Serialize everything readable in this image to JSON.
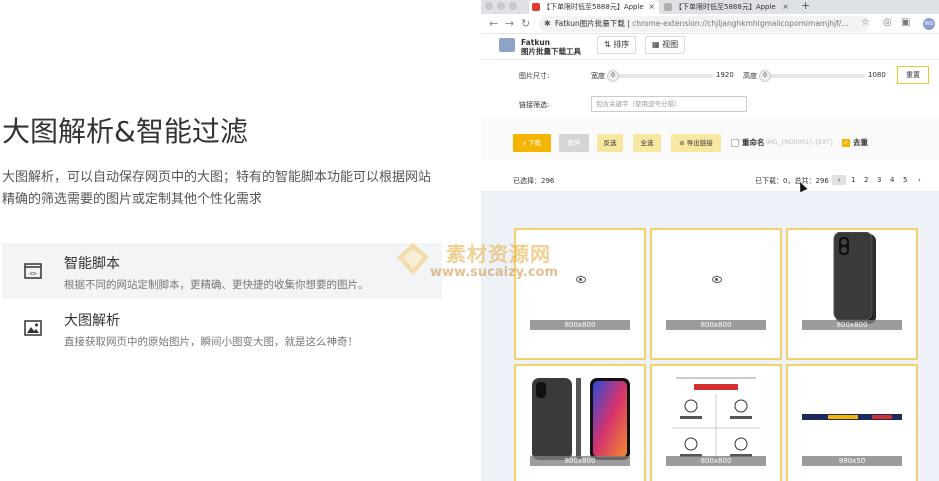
{
  "hero": {
    "title": "大图解析&智能过滤",
    "description": "大图解析，可以自动保存网页中的大图；特有的智能脚本功能可以根据网站精确的筛选需要的图片或定制其他个性化需求"
  },
  "features": [
    {
      "icon": "code-window-icon",
      "name": "智能脚本",
      "desc": "根据不同的网站定制脚本，更精确、更快捷的收集你想要的图片。"
    },
    {
      "icon": "image-icon",
      "name": "大图解析",
      "desc": "直接获取网页中的原始图片，瞬间小图变大图，就是这么神奇！"
    }
  ],
  "browser": {
    "tabs": [
      {
        "title": "【下单限时低至5888元】Apple",
        "close": "×"
      },
      {
        "title": "【下单限时低至5888元】Apple",
        "close": "×"
      }
    ],
    "new_tab": "+",
    "omnibox": {
      "site": "Fatkun图片批量下载",
      "url": "chrome-extension://chjljanghkmhlgmaiicopomimamjhjf/..."
    },
    "profile": "WG"
  },
  "extension": {
    "brand_line1": "Fatkun",
    "brand_line2": "图片批量下载工具",
    "sort_label": "排序",
    "view_label": "视图",
    "size_label": "图片尺寸:",
    "width_label": "宽度",
    "width_min": "0",
    "width_max": "1920",
    "height_label": "高度",
    "height_min": "0",
    "height_max": "1080",
    "reset_label": "重置",
    "filter_label": "链接筛选:",
    "filter_placeholder": "包含关键字（使用逗号分隔）",
    "actions": {
      "download": "下载",
      "pause": "暂停",
      "invert": "反选",
      "select_all": "全选",
      "export_links": "导出链接",
      "rename": "重命名",
      "rename_placeholder": "IMG_{NO0001}.{EXT}",
      "dedupe": "去重"
    },
    "status": {
      "selected": "已选择：296",
      "progress": "已下载：0，总共：296",
      "pages": [
        "1",
        "2",
        "3",
        "4",
        "5"
      ],
      "prev": "‹",
      "next": "›"
    },
    "images": [
      {
        "size": "800x800",
        "kind": "placeholder"
      },
      {
        "size": "800x800",
        "kind": "placeholder"
      },
      {
        "size": "800x800",
        "kind": "phone-back"
      },
      {
        "size": "800x800",
        "kind": "phones"
      },
      {
        "size": "800x800",
        "kind": "infographic"
      },
      {
        "size": "990x50",
        "kind": "banner"
      }
    ]
  },
  "watermark": {
    "text": "素材资源网",
    "url": "www.sucaizy.com"
  },
  "colors": {
    "accent": "#f4b400",
    "card_border": "#f2d16b",
    "grid_bg": "#eef2f8"
  }
}
